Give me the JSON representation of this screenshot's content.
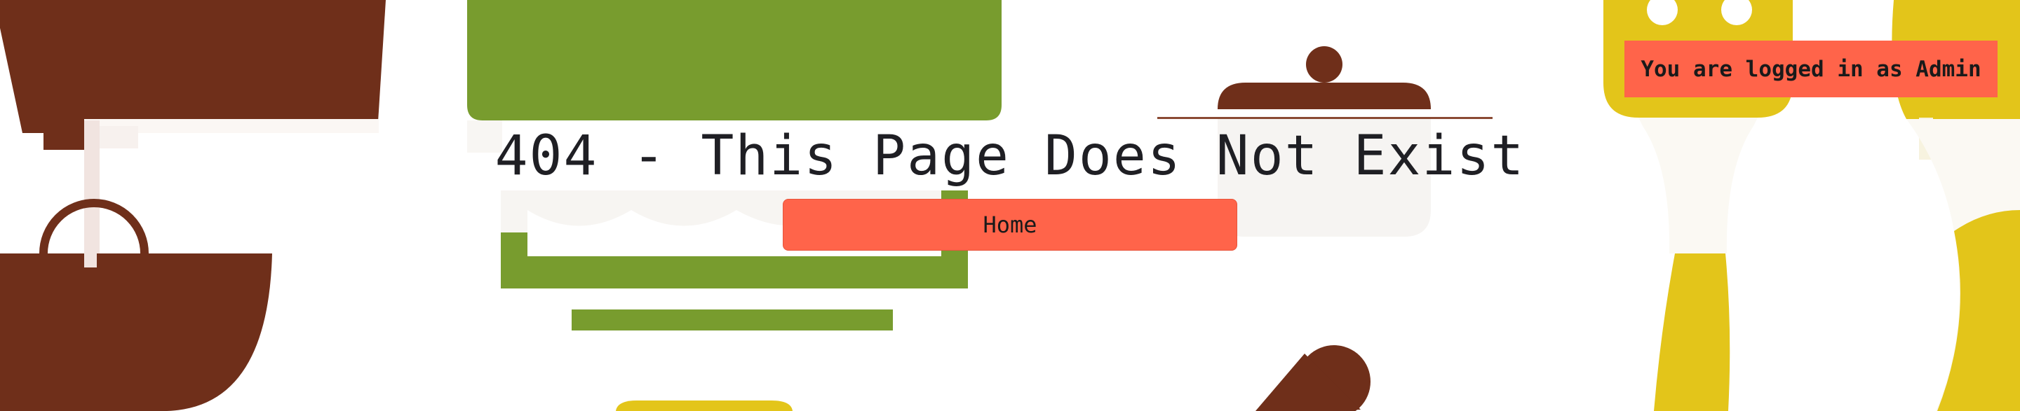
{
  "session": {
    "login_status": "You are logged in as Admin"
  },
  "main": {
    "title": "404 - This Page Does Not Exist",
    "home_label": "Home"
  },
  "colors": {
    "accent": "#ff644a",
    "brown": "#6f2f1a",
    "green": "#789c2e",
    "yellow": "#e3c51a",
    "text": "#1f1f24"
  },
  "decorations": [
    "stand-mixer-illustration",
    "measuring-cups-illustration",
    "covered-pot-illustration",
    "rolling-pin-illustration",
    "fork-illustration",
    "spoon-illustration"
  ]
}
